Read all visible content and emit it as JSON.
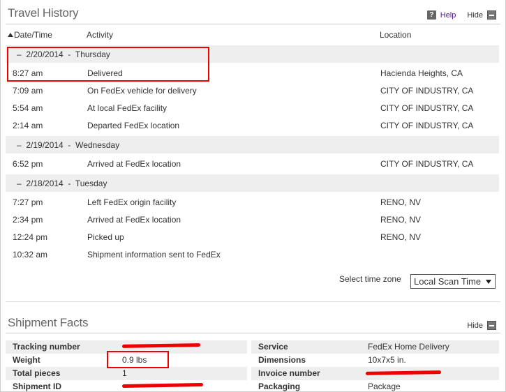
{
  "travel_history": {
    "title": "Travel History",
    "help": "Help",
    "hide": "Hide",
    "columns": {
      "date_time": "Date/Time",
      "activity": "Activity",
      "location": "Location"
    },
    "groups": [
      {
        "date": "2/20/2014",
        "day": "Thursday",
        "events": [
          {
            "time": "8:27 am",
            "activity": "Delivered",
            "location": "Hacienda Heights, CA"
          },
          {
            "time": "7:09 am",
            "activity": "On FedEx vehicle for delivery",
            "location": "CITY OF INDUSTRY, CA"
          },
          {
            "time": "5:54 am",
            "activity": "At local FedEx facility",
            "location": "CITY OF INDUSTRY, CA"
          },
          {
            "time": "2:14 am",
            "activity": "Departed FedEx location",
            "location": "CITY OF INDUSTRY, CA"
          }
        ]
      },
      {
        "date": "2/19/2014",
        "day": "Wednesday",
        "events": [
          {
            "time": "6:52 pm",
            "activity": "Arrived at FedEx location",
            "location": "CITY OF INDUSTRY, CA"
          }
        ]
      },
      {
        "date": "2/18/2014",
        "day": "Tuesday",
        "events": [
          {
            "time": "7:27 pm",
            "activity": "Left FedEx origin facility",
            "location": "RENO, NV"
          },
          {
            "time": "2:34 pm",
            "activity": "Arrived at FedEx location",
            "location": "RENO, NV"
          },
          {
            "time": "12:24 pm",
            "activity": "Picked up",
            "location": "RENO, NV"
          },
          {
            "time": "10:32 am",
            "activity": "Shipment information sent to FedEx",
            "location": ""
          }
        ]
      }
    ],
    "timezone": {
      "label": "Select time zone",
      "selected": "Local Scan Time"
    }
  },
  "shipment_facts": {
    "title": "Shipment Facts",
    "hide": "Hide",
    "left": [
      {
        "label": "Tracking number",
        "value": ""
      },
      {
        "label": "Weight",
        "value": "0.9 lbs"
      },
      {
        "label": "Total pieces",
        "value": "1"
      },
      {
        "label": "Shipment ID",
        "value": ""
      }
    ],
    "right": [
      {
        "label": "Service",
        "value": "FedEx Home Delivery"
      },
      {
        "label": "Dimensions",
        "value": "10x7x5 in."
      },
      {
        "label": "Invoice number",
        "value": ""
      },
      {
        "label": "Packaging",
        "value": "Package"
      }
    ]
  },
  "colors": {
    "highlight_box": "#ee0000",
    "redaction": "#ee0000",
    "help_link": "#4d148c",
    "row_shade": "#eeeeee"
  },
  "icons": {
    "help": "help-icon",
    "hide": "minus-box-icon",
    "sort": "sort-up-icon",
    "select": "chevron-down-icon"
  }
}
